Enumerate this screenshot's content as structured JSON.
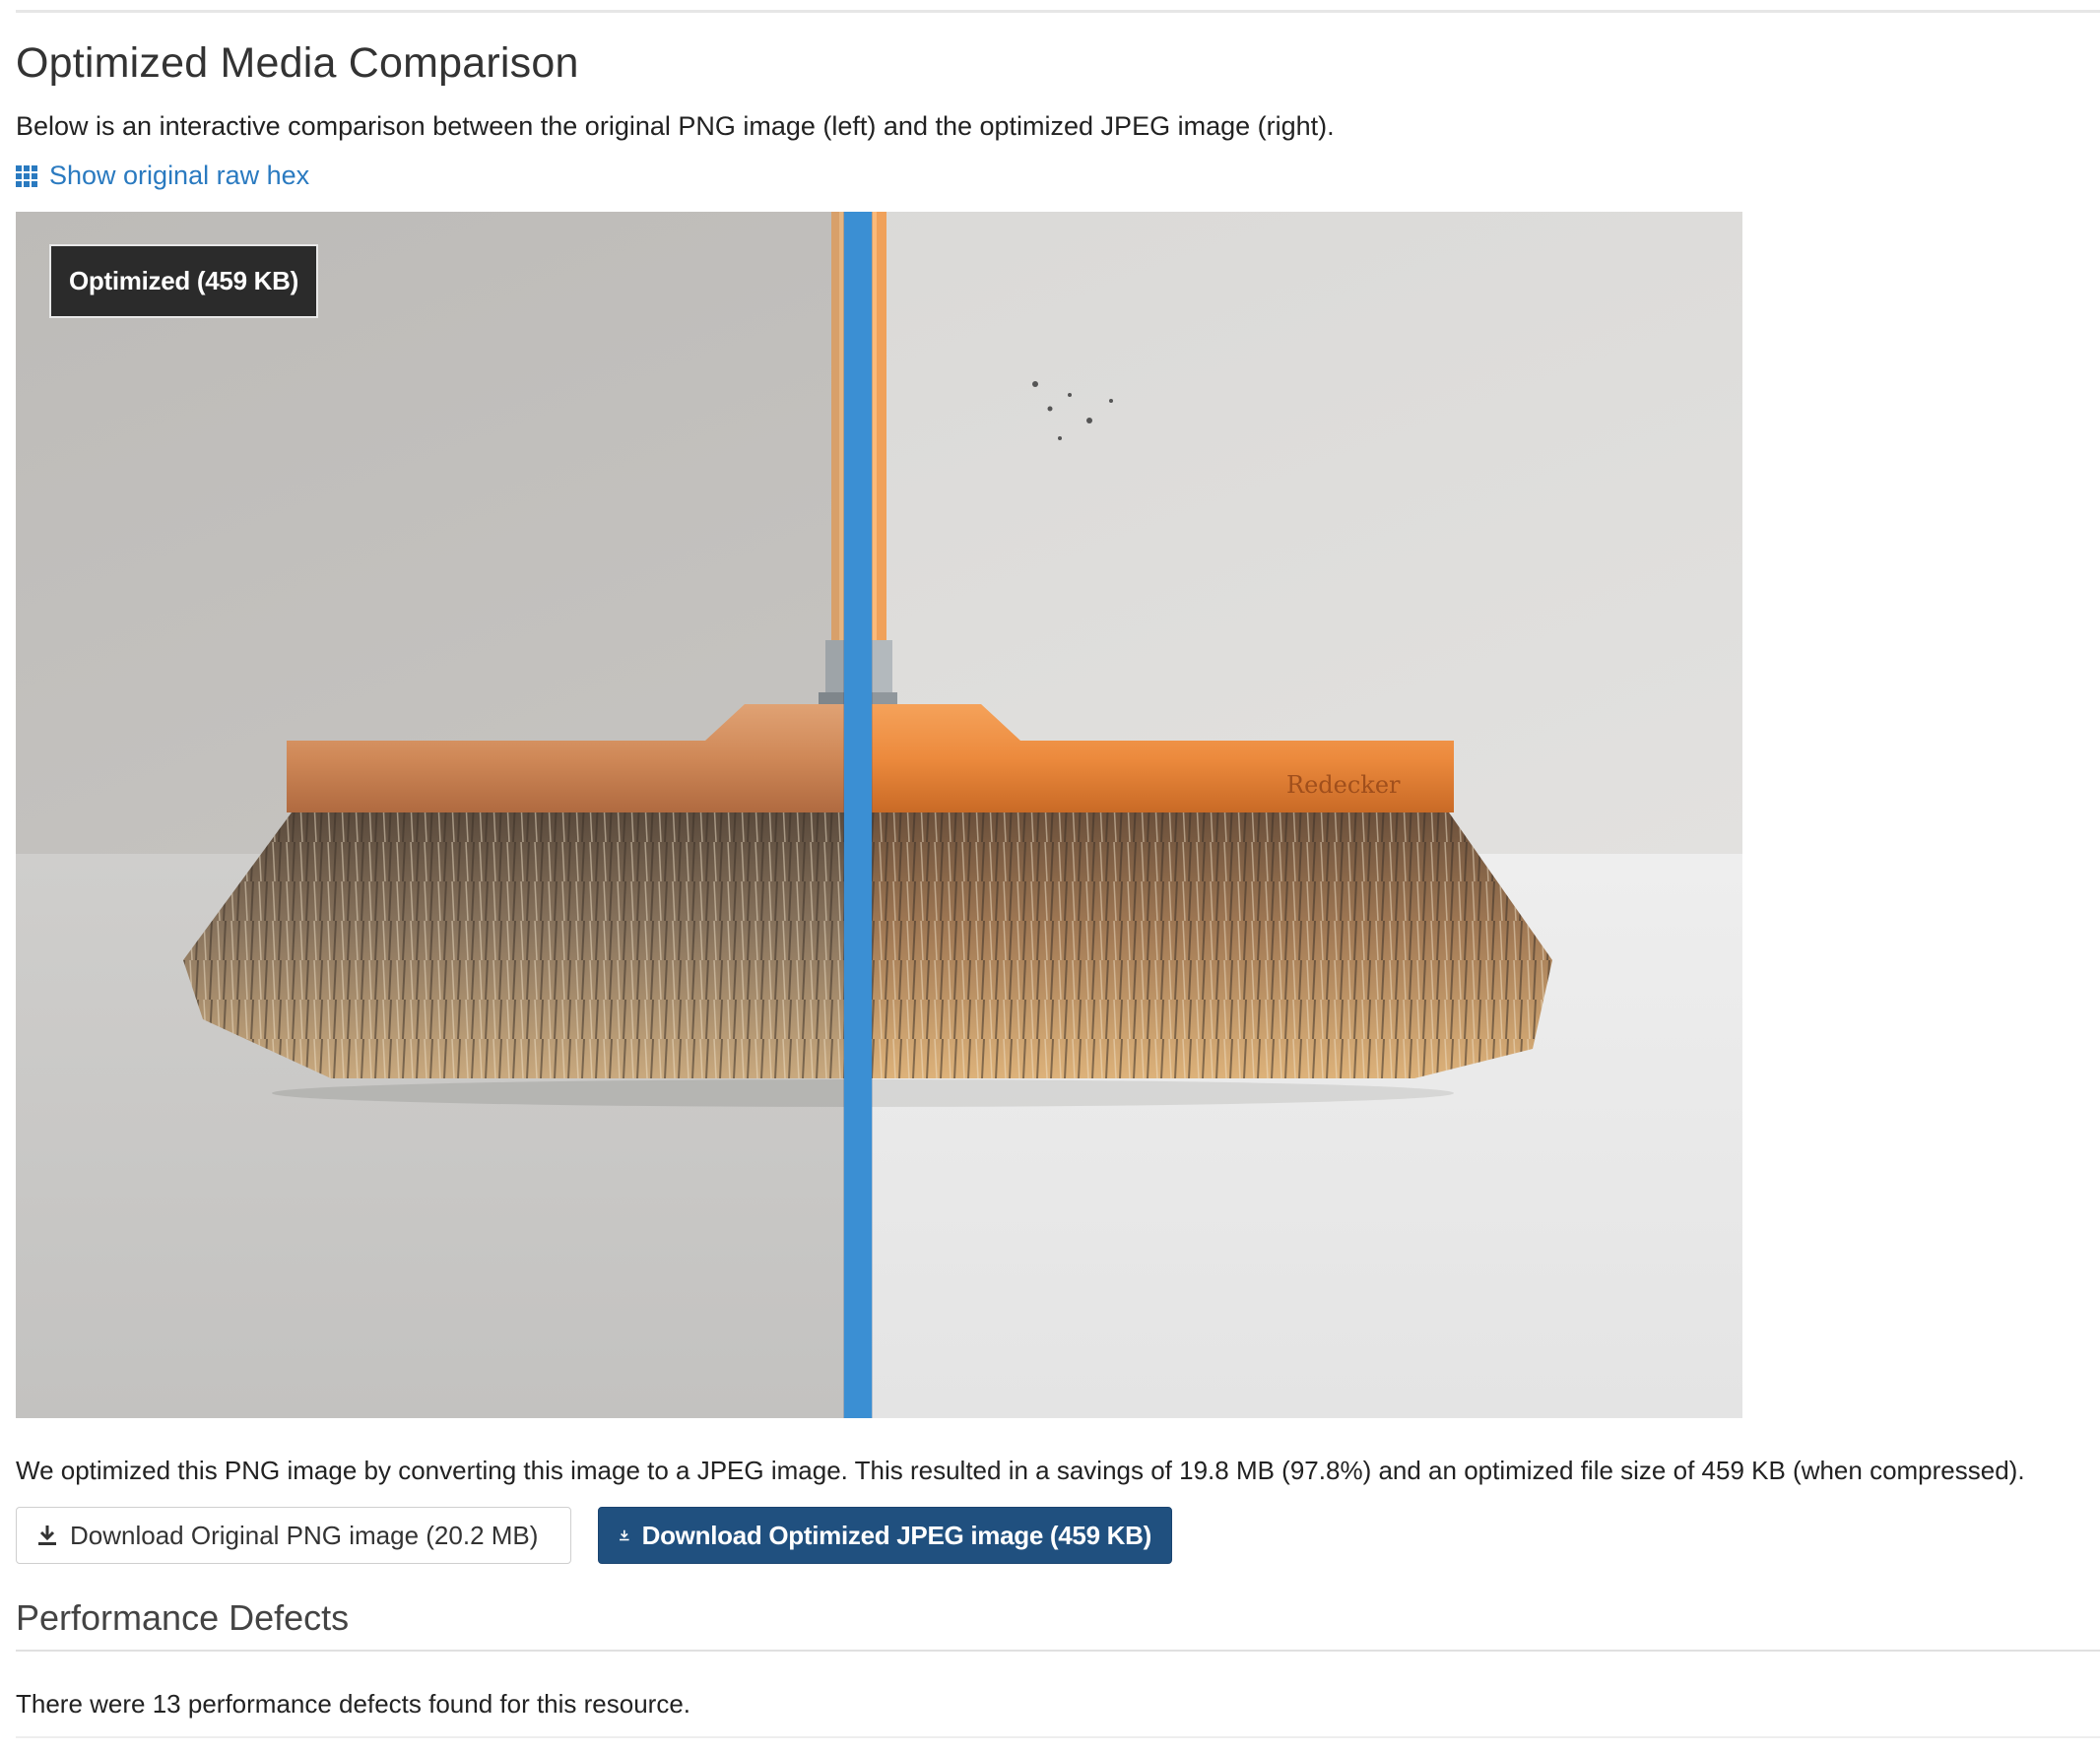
{
  "section": {
    "title": "Optimized Media Comparison",
    "intro": "Below is an interactive comparison between the original PNG image (left) and the optimized JPEG image (right).",
    "hex_link": "Show original raw hex",
    "hex_icon": "grid-icon"
  },
  "comparison": {
    "overlay_label": "Optimized (459 KB)",
    "brand_text": "Redecker",
    "divider_color": "#3b8fd3"
  },
  "savings_text": "We optimized this PNG image by converting this image to a JPEG image. This resulted in a savings of 19.8 MB (97.8%) and an optimized file size of 459 KB (when compressed).",
  "buttons": {
    "download_original": "Download Original PNG image (20.2 MB)",
    "download_optimized": "Download Optimized JPEG image (459 KB)",
    "icon": "download-icon"
  },
  "performance": {
    "title": "Performance Defects",
    "text": "There were 13 performance defects found for this resource."
  },
  "colors": {
    "link": "#2a7ac0",
    "primary_button": "#20507f"
  }
}
